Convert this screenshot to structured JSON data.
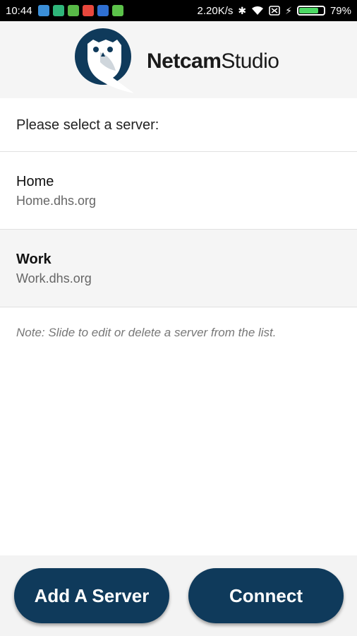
{
  "status_bar": {
    "time": "10:44",
    "net_speed": "2.20K/s",
    "battery_percent": "79%",
    "battery_level": 0.79,
    "notification_icons": [
      "usb-icon",
      "shield-app-icon",
      "android-app-icon",
      "location-app-icon",
      "calendar-app-icon",
      "android-robot-icon"
    ]
  },
  "header": {
    "brand_bold": "Netcam",
    "brand_regular": "Studio",
    "logo_icon": "owl-logo-icon"
  },
  "list": {
    "prompt": "Please select a server:",
    "servers": [
      {
        "name": "Home",
        "host": "Home.dhs.org",
        "selected": false
      },
      {
        "name": "Work",
        "host": "Work.dhs.org",
        "selected": true
      }
    ],
    "note": "Note: Slide to edit or delete a server from the list."
  },
  "buttons": {
    "add_label": "Add A Server",
    "connect_label": "Connect"
  },
  "colors": {
    "accent": "#0f3a5b",
    "header_bg": "#f5f5f5",
    "selected_bg": "#f5f5f5"
  }
}
